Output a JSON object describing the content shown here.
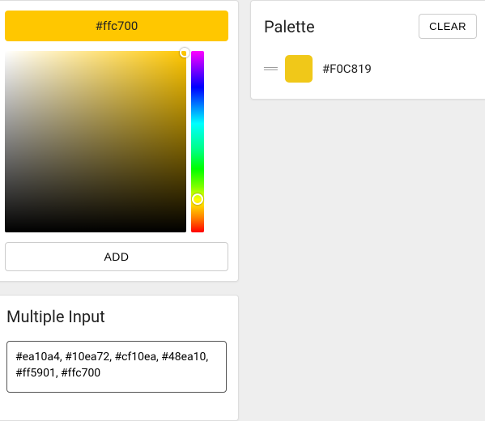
{
  "picker": {
    "current_hex": "#ffc700",
    "add_label": "ADD"
  },
  "multi": {
    "title": "Multiple Input",
    "value": "#ea10a4, #10ea72, #cf10ea, #48ea10, #ff5901, #ffc700"
  },
  "palette": {
    "title": "Palette",
    "clear_label": "CLEAR",
    "items": [
      {
        "color": "#F0C819",
        "label": "#F0C819"
      }
    ]
  }
}
